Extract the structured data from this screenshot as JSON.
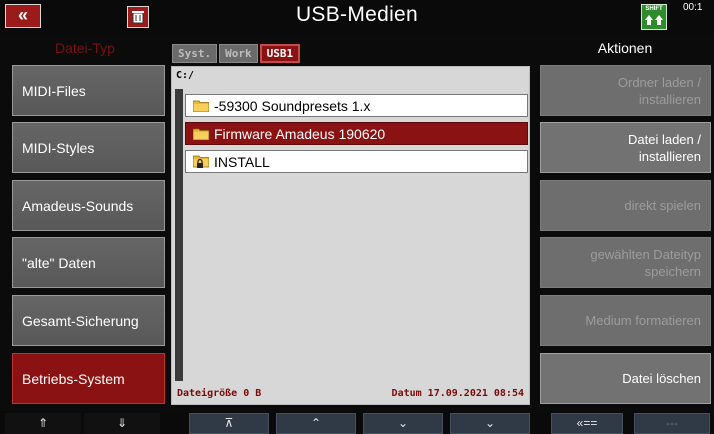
{
  "header": {
    "title": "USB-Medien",
    "back_label": "«",
    "shift_label": "SHIFT",
    "time": "00:1"
  },
  "left_panel": {
    "header": "Datei-Typ",
    "items": [
      {
        "label": "MIDI-Files"
      },
      {
        "label": "MIDI-Styles"
      },
      {
        "label": "Amadeus-Sounds"
      },
      {
        "label": "\"alte\" Daten"
      },
      {
        "label": "Gesamt-Sicherung"
      },
      {
        "label": "Betriebs-System",
        "active": true
      }
    ]
  },
  "browser": {
    "tabs": [
      {
        "label": "Syst."
      },
      {
        "label": "Work"
      },
      {
        "label": "USB1",
        "active": true
      }
    ],
    "path": "C:/",
    "files": [
      {
        "name": "-59300 Soundpresets 1.x",
        "icon": "folder-icon"
      },
      {
        "name": "Firmware Amadeus 190620",
        "icon": "folder-icon",
        "selected": true
      },
      {
        "name": "INSTALL",
        "icon": "folder-lock-icon"
      }
    ],
    "file_size": "Dateigröße 0 B",
    "date": "Datum 17.09.2021  08:54"
  },
  "right_panel": {
    "header": "Aktionen",
    "buttons": [
      {
        "line1": "Ordner laden  /",
        "line2": "installieren"
      },
      {
        "line1": "Datei laden  /",
        "line2": "installieren"
      },
      {
        "line1": "direkt spielen",
        "line2": ""
      },
      {
        "line1": "gewählten Dateityp",
        "line2": "speichern"
      },
      {
        "line1": "Medium formatieren",
        "line2": ""
      },
      {
        "line1": "Datei löschen",
        "line2": ""
      }
    ]
  },
  "bottom_nav": {
    "buttons": [
      {
        "label": "⇑",
        "icon": "double-up-icon"
      },
      {
        "label": "⇓",
        "icon": "double-down-icon"
      },
      {
        "label": "⊼",
        "icon": "top-icon"
      },
      {
        "label": "⌃",
        "icon": "up-icon"
      },
      {
        "label": "⌄",
        "icon": "down-icon"
      },
      {
        "label": "⌄",
        "icon": "chevron-down-icon"
      },
      {
        "label": "«==",
        "icon": "back-arrow-icon"
      },
      {
        "label": "---",
        "icon": ""
      }
    ]
  },
  "colors": {
    "accent_red": "#8a1212",
    "button_gray": "#666666",
    "shift_green": "#2f8c2c",
    "nav_blue": "#2f3a46"
  }
}
